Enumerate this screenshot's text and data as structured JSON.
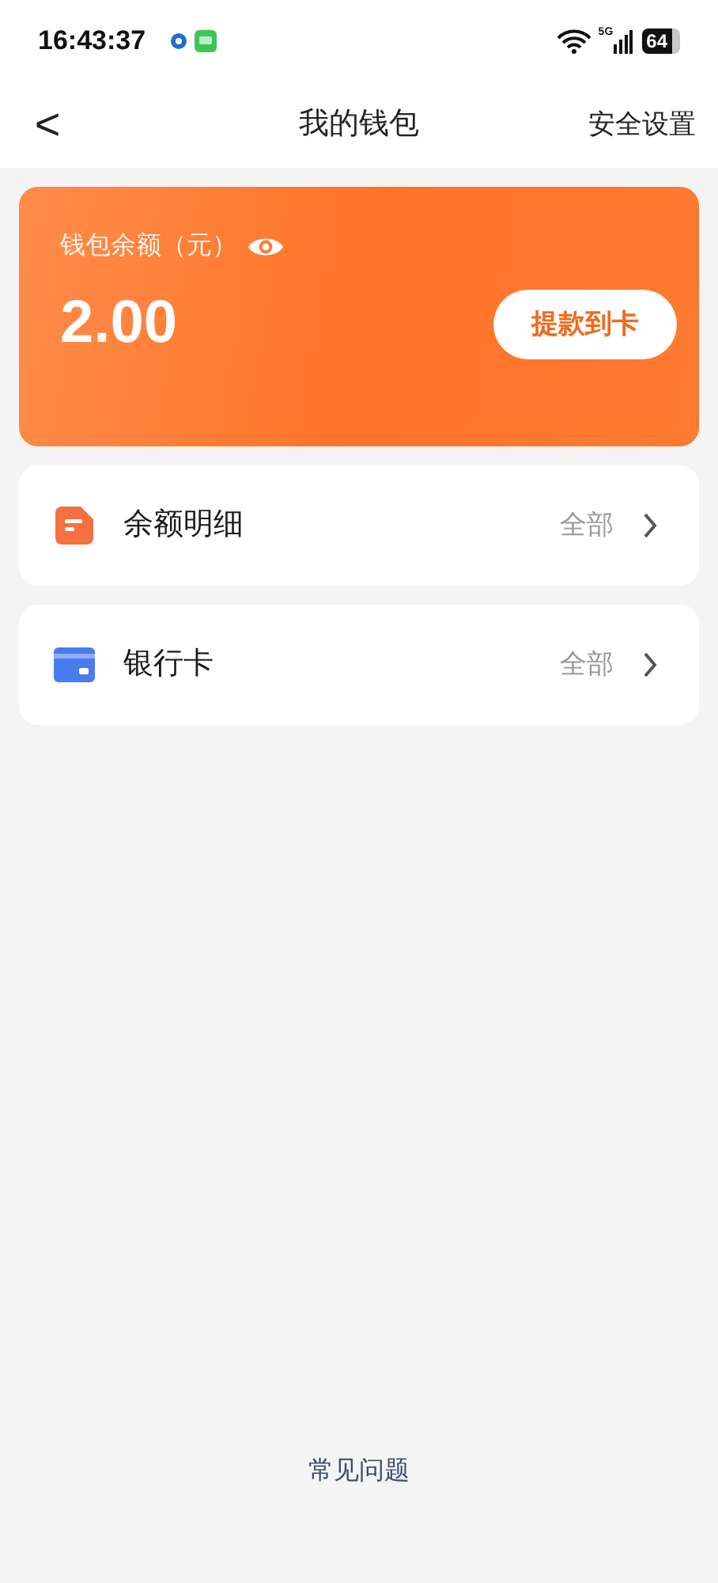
{
  "status_bar": {
    "time": "16:43:37",
    "battery": "64",
    "network": "5G"
  },
  "header": {
    "back": "<",
    "title": "我的钱包",
    "action": "安全设置"
  },
  "balance_card": {
    "label": "钱包余额（元）",
    "amount": "2.00",
    "button": "提款到卡"
  },
  "menu": [
    {
      "kind": "detail",
      "label": "余额明细",
      "value": "全部"
    },
    {
      "kind": "bank",
      "label": "银行卡",
      "value": "全部"
    }
  ],
  "footer": {
    "link": "常见问题"
  }
}
